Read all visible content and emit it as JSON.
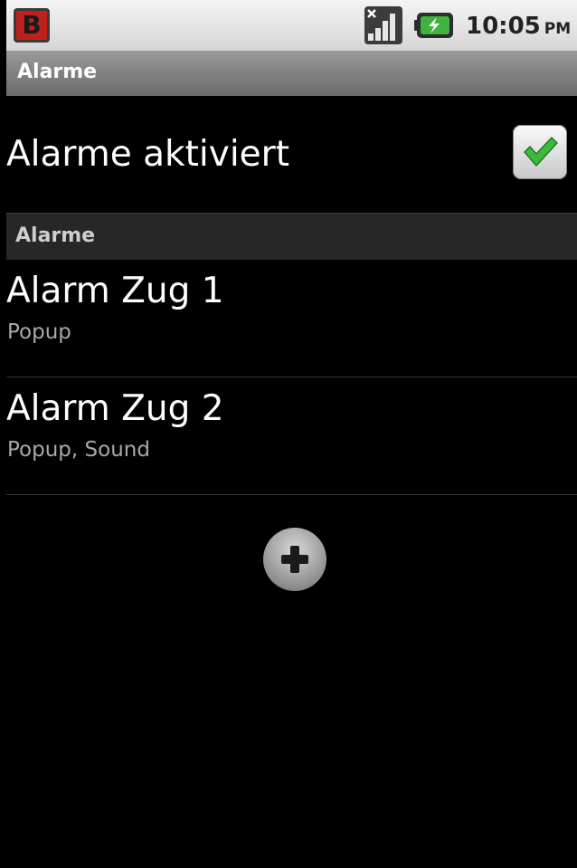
{
  "status_bar": {
    "app_icon_letter": "B",
    "signal_icon": "signal-no-sim-icon",
    "battery_icon": "battery-charging-icon",
    "time": "10:05",
    "ampm": "PM"
  },
  "title_bar": {
    "title": "Alarme"
  },
  "enable_row": {
    "label": "Alarme aktiviert",
    "checked": true
  },
  "section": {
    "header": "Alarme"
  },
  "alarms": [
    {
      "title": "Alarm Zug 1",
      "subtitle": "Popup"
    },
    {
      "title": "Alarm Zug 2",
      "subtitle": "Popup, Sound"
    }
  ],
  "add_button": {
    "icon": "plus-icon"
  },
  "colors": {
    "checkmark": "#3cb83c",
    "app_icon": "#c0201c",
    "background": "#000000"
  }
}
